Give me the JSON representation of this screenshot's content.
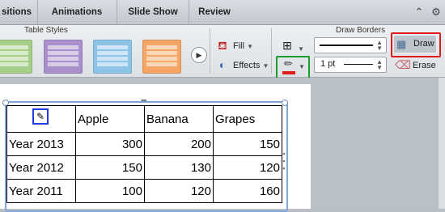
{
  "tabs": [
    "sitions",
    "Animations",
    "Slide Show",
    "Review"
  ],
  "ribbon": {
    "table_styles_title": "Table Styles",
    "draw_borders_title": "Draw Borders",
    "fill_label": "Fill",
    "effects_label": "Effects",
    "line_weight": "1 pt",
    "draw_label": "Draw",
    "erase_label": "Erase",
    "style_colors": [
      "#a6d08a",
      "#a98fcb",
      "#8ec3e8",
      "#f4a565"
    ],
    "highlight_colors": {
      "draw": "#e01b1b",
      "pen": "#1f9d2a",
      "cell": "#1f3de0"
    }
  },
  "table": {
    "header": [
      "Apple",
      "Banana",
      "Grapes"
    ],
    "rows": [
      {
        "label": "Year 2013",
        "values": [
          "300",
          "200",
          "150"
        ]
      },
      {
        "label": "Year 2012",
        "values": [
          "150",
          "130",
          "120"
        ]
      },
      {
        "label": "Year 2011",
        "values": [
          "100",
          "120",
          "160"
        ]
      }
    ]
  }
}
